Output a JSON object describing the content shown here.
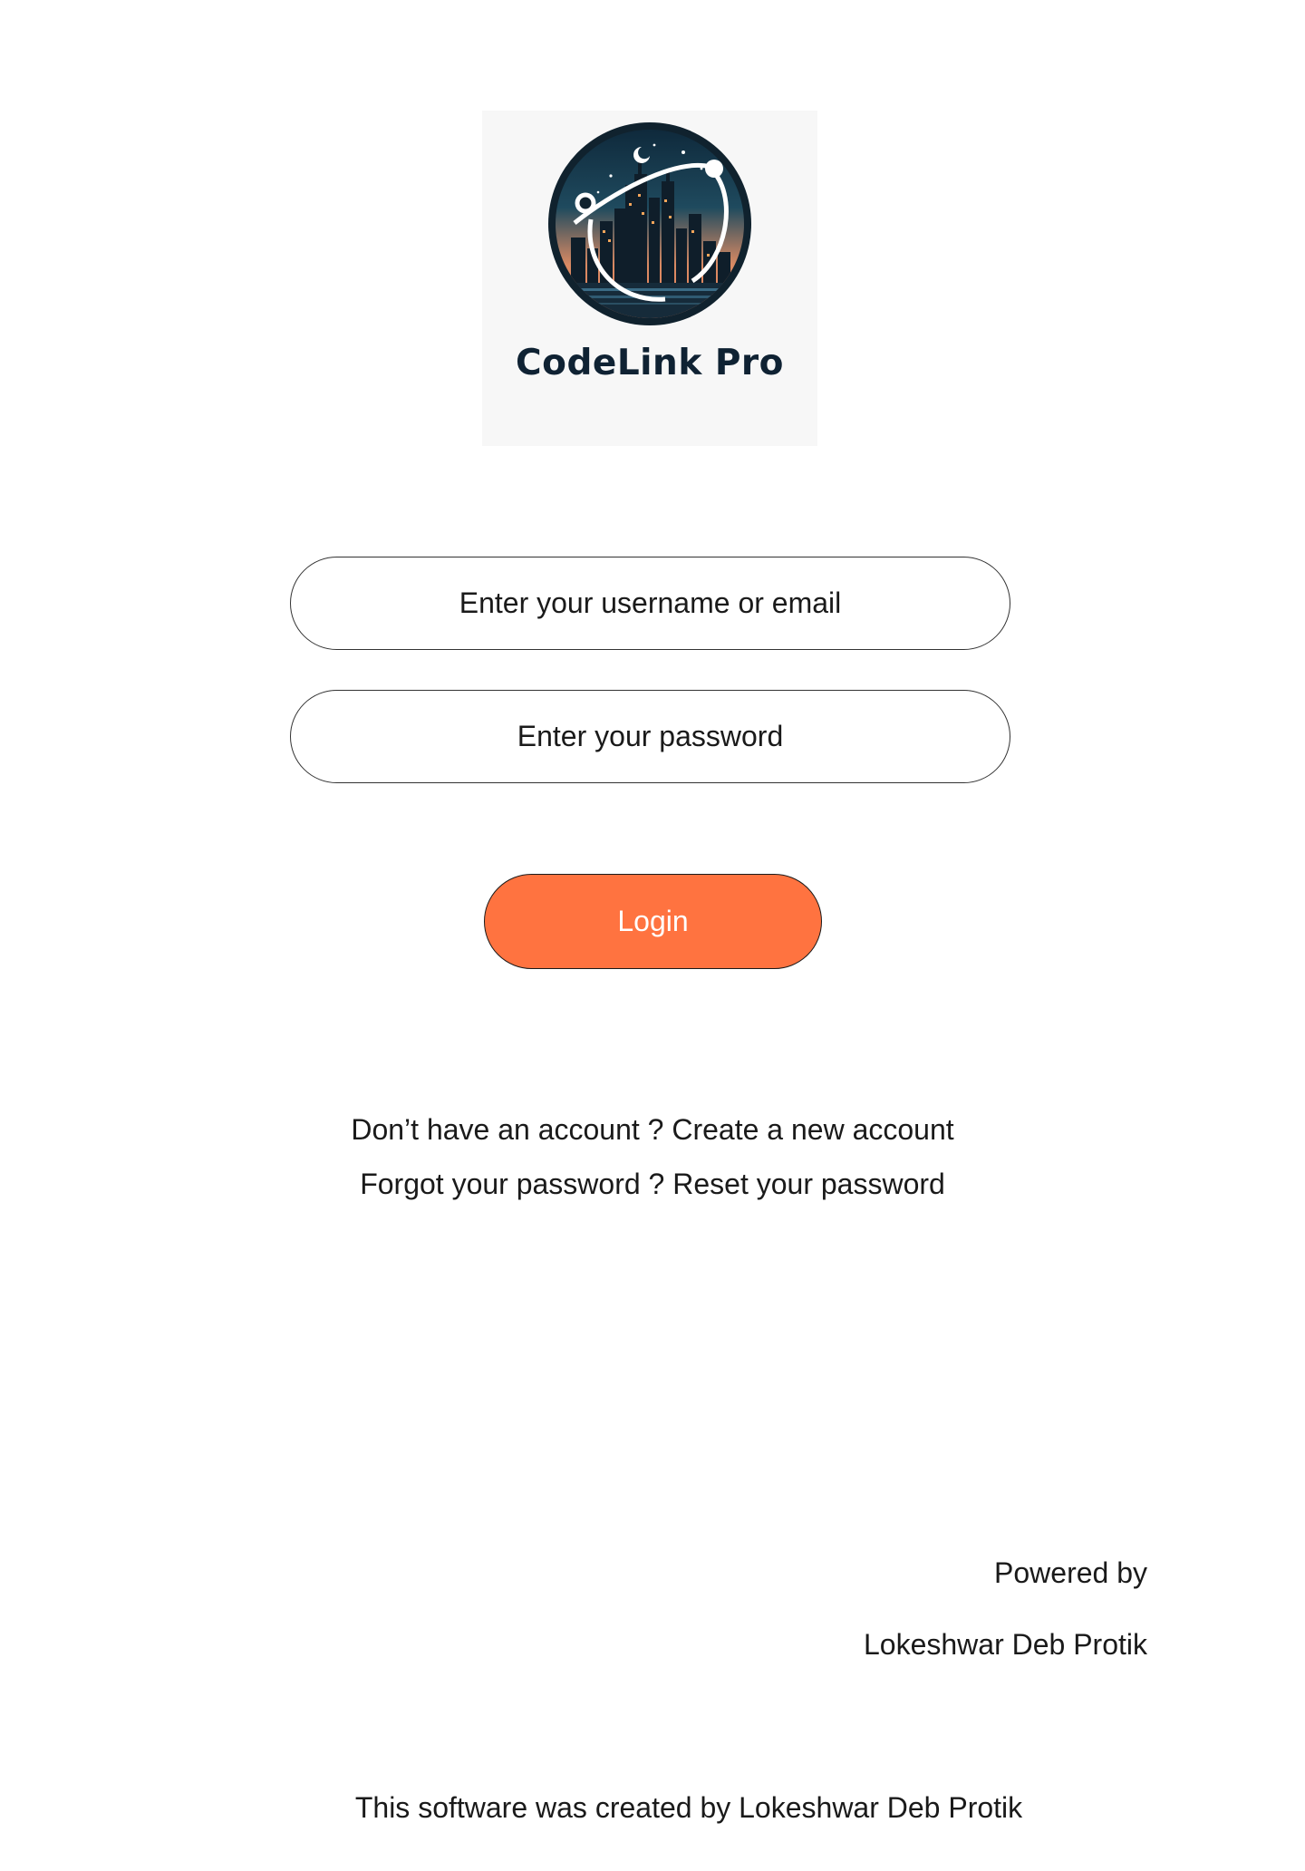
{
  "logo": {
    "brand_name": "CodeLink Pro",
    "icon": "city-skyline-orbit-logo"
  },
  "login_form": {
    "username_placeholder": "Enter your username or email",
    "password_placeholder": "Enter your password",
    "login_label": "Login"
  },
  "links": {
    "signup_prompt": "Don’t have an account ? ",
    "signup_action": "Create a new account",
    "reset_prompt": "Forgot your password ? ",
    "reset_action": "Reset your password"
  },
  "powered": {
    "label": "Powered by",
    "name": "Lokeshwar Deb Protik"
  },
  "footer": {
    "credit": "This software was created by Lokeshwar Deb Protik"
  },
  "colors": {
    "login_button": "#ff7340",
    "logo_text": "#0f2233",
    "logo_card_bg": "#f7f7f7"
  }
}
